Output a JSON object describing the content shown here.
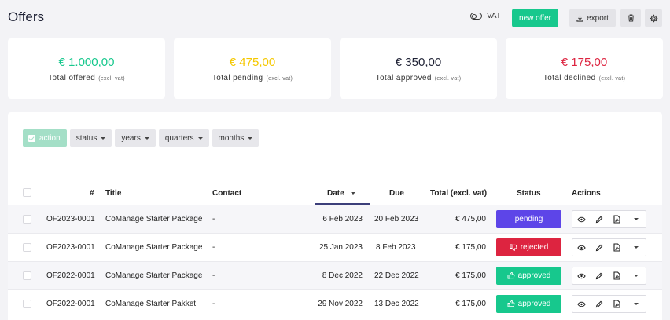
{
  "header": {
    "title": "Offers",
    "vat_label": "VAT",
    "new_offer_label": "new offer",
    "export_label": "export"
  },
  "cards": [
    {
      "value": "€ 1.000,00",
      "label": "Total offered",
      "note": "(excl. vat)",
      "color": "#17c88d"
    },
    {
      "value": "€ 475,00",
      "label": "Total pending",
      "note": "(excl. vat)",
      "color": "#f5c800"
    },
    {
      "value": "€ 350,00",
      "label": "Total approved",
      "note": "(excl. vat)",
      "color": "#1f2235"
    },
    {
      "value": "€ 175,00",
      "label": "Total declined",
      "note": "(excl. vat)",
      "color": "#dd2440"
    }
  ],
  "filters": {
    "action": "action",
    "status": "status",
    "years": "years",
    "quarters": "quarters",
    "months": "months"
  },
  "table": {
    "columns": {
      "number": "#",
      "title": "Title",
      "contact": "Contact",
      "date": "Date",
      "due": "Due",
      "total": "Total (excl. vat)",
      "status": "Status",
      "actions": "Actions"
    },
    "rows": [
      {
        "number": "OF2023-0001",
        "title": "CoManage Starter Package",
        "contact": "-",
        "date": "6 Feb 2023",
        "due": "20 Feb 2023",
        "total": "€ 475,00",
        "status": "pending"
      },
      {
        "number": "OF2023-0001",
        "title": "CoManage Starter Package",
        "contact": "-",
        "date": "25 Jan 2023",
        "due": "8 Feb 2023",
        "total": "€ 175,00",
        "status": "rejected"
      },
      {
        "number": "OF2022-0001",
        "title": "CoManage Starter Package",
        "contact": "-",
        "date": "8 Dec 2022",
        "due": "22 Dec 2022",
        "total": "€ 175,00",
        "status": "approved"
      },
      {
        "number": "OF2022-0001",
        "title": "CoManage Starter Pakket",
        "contact": "-",
        "date": "29 Nov 2022",
        "due": "13 Dec 2022",
        "total": "€ 175,00",
        "status": "approved"
      }
    ]
  },
  "colors": {
    "accent_green": "#17c88d",
    "pending": "#5d45e8",
    "rejected": "#dd2440",
    "approved": "#17c88d"
  }
}
